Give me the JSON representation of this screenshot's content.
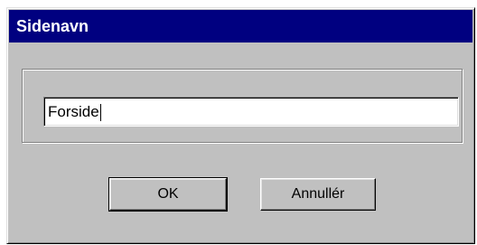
{
  "window": {
    "title": "Sidenavn"
  },
  "page_name_field": {
    "value": "Forside"
  },
  "buttons": {
    "ok_label": "OK",
    "cancel_label": "Annullér"
  },
  "colors": {
    "titlebar": "#000080",
    "dialog_face": "#c0c0c0"
  }
}
